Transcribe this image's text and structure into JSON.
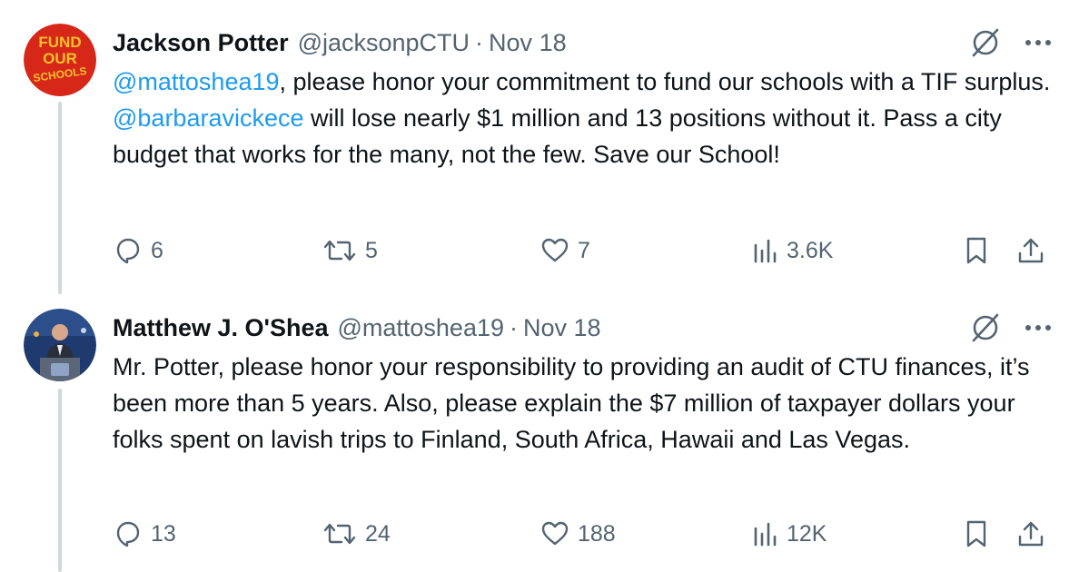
{
  "tweets": [
    {
      "author_name": "Jackson Potter",
      "handle": "@jacksonpCTU",
      "separator": "·",
      "date": "Nov 18",
      "avatar": {
        "kind": "fund-our-schools-logo",
        "lines": [
          "FUND",
          "OUR",
          "SCHOOLS"
        ],
        "bg": "#d62718",
        "fg": "#f6c22b"
      },
      "body": {
        "mention_1": "@mattoshea19",
        "text_1": ", please honor your commitment to fund our schools with a TIF surplus. ",
        "mention_2": "@barbaravickece",
        "text_2": " will lose nearly $1 million and 13 positions without it. Pass a city budget that works for the many, not the few. Save our School!"
      },
      "stats": {
        "replies": "6",
        "reposts": "5",
        "likes": "7",
        "views": "3.6K"
      },
      "icons": [
        "grok-icon",
        "more-icon",
        "reply-icon",
        "repost-icon",
        "like-icon",
        "views-icon",
        "bookmark-icon",
        "share-icon"
      ]
    },
    {
      "author_name": "Matthew J. O'Shea",
      "handle": "@mattoshea19",
      "separator": "·",
      "date": "Nov 18",
      "avatar": {
        "kind": "photo-man-at-podium"
      },
      "body": {
        "text": "Mr. Potter, please honor your responsibility to providing an audit of CTU finances, it’s been more than 5 years. Also, please explain the $7 million of taxpayer dollars your folks spent on lavish trips to Finland, South Africa, Hawaii and Las Vegas."
      },
      "stats": {
        "replies": "13",
        "reposts": "24",
        "likes": "188",
        "views": "12K"
      },
      "icons": [
        "grok-icon",
        "more-icon",
        "reply-icon",
        "repost-icon",
        "like-icon",
        "views-icon",
        "bookmark-icon",
        "share-icon"
      ]
    }
  ],
  "colors": {
    "text": "#0f1419",
    "secondary": "#536471",
    "link": "#1d9bf0",
    "thread_line": "#cfd9de"
  }
}
